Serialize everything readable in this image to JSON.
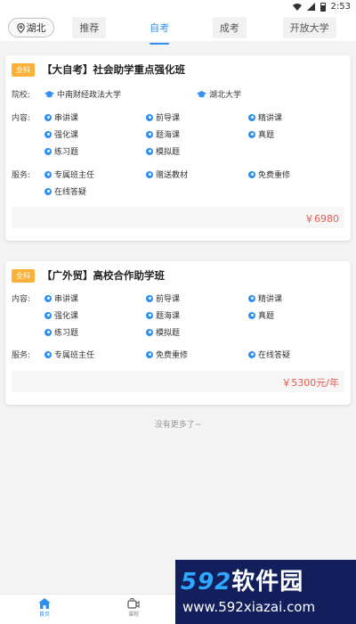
{
  "status_bar": {
    "time": "2:53"
  },
  "header": {
    "location": "湖北",
    "tabs": [
      {
        "label": "推荐",
        "active": false
      },
      {
        "label": "自考",
        "active": true
      },
      {
        "label": "成考",
        "active": false
      },
      {
        "label": "开放大学",
        "active": false
      }
    ]
  },
  "courses": [
    {
      "badge": "全科",
      "title": "【大自考】社会助学重点强化班",
      "school_label": "院校:",
      "schools": [
        "中南财经政法大学",
        "湖北大学"
      ],
      "content_label": "内容:",
      "contents": [
        "串讲课",
        "前导课",
        "精讲课",
        "强化课",
        "题海课",
        "真题",
        "练习题",
        "模拟题"
      ],
      "service_label": "服务:",
      "services": [
        "专属班主任",
        "赠送教材",
        "免费重修",
        "在线答疑"
      ],
      "price": "￥6980"
    },
    {
      "badge": "全科",
      "title": "【广外贸】高校合作助学班",
      "content_label": "内容:",
      "contents": [
        "串讲课",
        "前导课",
        "精讲课",
        "强化课",
        "题海课",
        "真题",
        "练习题",
        "模拟题"
      ],
      "service_label": "服务:",
      "services": [
        "专属班主任",
        "免费重修",
        "在线答疑"
      ],
      "price": "￥5300元/年"
    }
  ],
  "footer_note": "没有更多了~",
  "bottom_nav": [
    {
      "label": "首页",
      "icon": "home-icon",
      "active": true
    },
    {
      "label": "课程",
      "icon": "video-icon",
      "active": false
    }
  ],
  "watermark": {
    "brand_num": "592",
    "brand_cn": "软件园",
    "url": "www.592xiazai.com"
  },
  "colors": {
    "accent": "#2f8ff0",
    "badge": "#fdb036",
    "price": "#e95a4e",
    "watermark_bg": "#131f5c"
  }
}
